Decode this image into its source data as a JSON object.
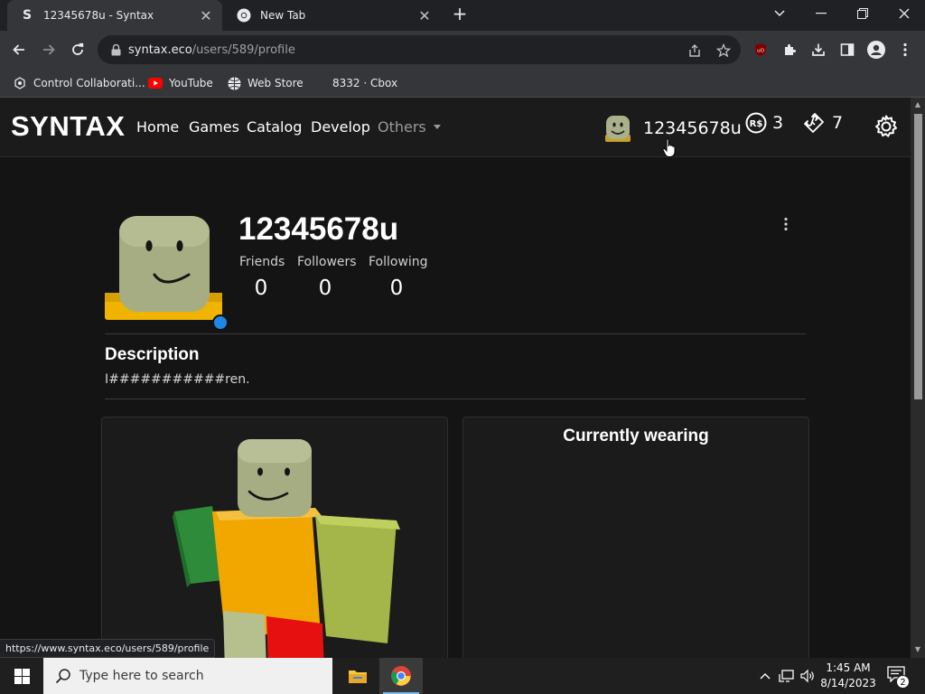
{
  "browser": {
    "tabs": [
      {
        "favicon": "S",
        "title": "12345678u - Syntax",
        "active": true
      },
      {
        "favicon": "chrome-icon",
        "title": "New Tab",
        "active": false
      }
    ],
    "url_host": "syntax.eco",
    "url_path": "/users/589/profile",
    "bookmarks": [
      {
        "label": "Control Collaborati...",
        "icon": "control-collab-icon"
      },
      {
        "label": "YouTube",
        "icon": "youtube-icon"
      },
      {
        "label": "Web Store",
        "icon": "web-store-icon"
      },
      {
        "label": "8332 · Cbox",
        "icon": ""
      }
    ],
    "status_url": "https://www.syntax.eco/users/589/profile"
  },
  "site": {
    "brand": "SYNTAX",
    "nav": [
      {
        "label": "Home"
      },
      {
        "label": "Games"
      },
      {
        "label": "Catalog"
      },
      {
        "label": "Develop"
      },
      {
        "label": "Others"
      }
    ],
    "user": {
      "name": "12345678u"
    },
    "robux": "3",
    "tickets": "7"
  },
  "profile": {
    "username": "12345678u",
    "stats": [
      {
        "label": "Friends",
        "value": "0"
      },
      {
        "label": "Followers",
        "value": "0"
      },
      {
        "label": "Following",
        "value": "0"
      }
    ],
    "description_title": "Description",
    "description": "I###########ren.",
    "wearing_title": "Currently wearing",
    "online_color": "#1e88e5"
  },
  "taskbar": {
    "search_placeholder": "Type here to search",
    "time": "1:45 AM",
    "date": "8/14/2023",
    "notification_count": "2"
  },
  "colors": {
    "page_bg": "#141414",
    "card_bg": "#1b1b1b",
    "accent_blue": "#1e88e5"
  }
}
